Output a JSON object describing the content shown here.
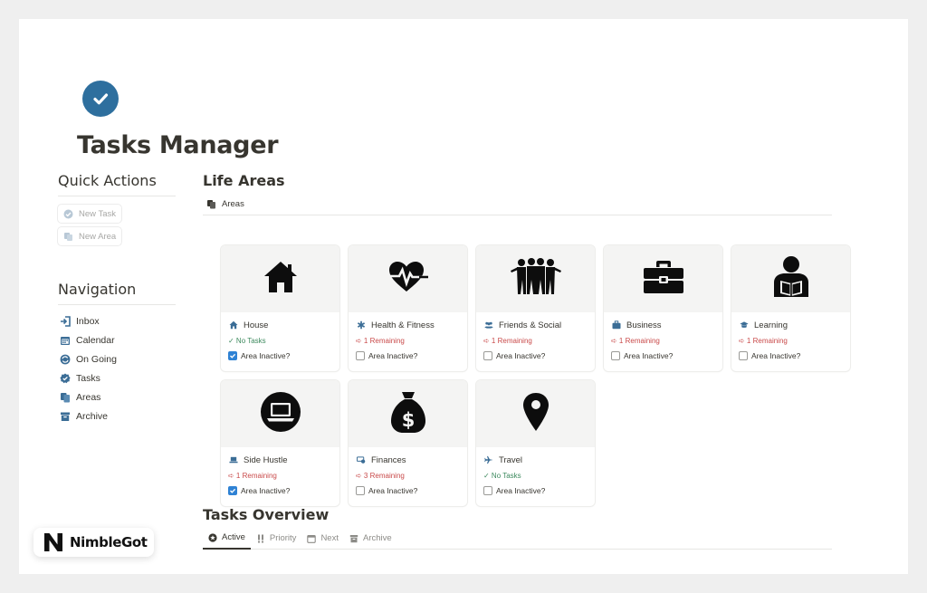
{
  "page": {
    "title": "Tasks Manager",
    "icon": "check-circle-icon"
  },
  "quick_actions": {
    "heading": "Quick Actions",
    "buttons": [
      {
        "label": "New Task",
        "icon": "check-badge-icon"
      },
      {
        "label": "New Area",
        "icon": "copy-icon"
      }
    ]
  },
  "navigation": {
    "heading": "Navigation",
    "items": [
      {
        "label": "Inbox",
        "icon": "inbox-icon"
      },
      {
        "label": "Calendar",
        "icon": "calendar-icon"
      },
      {
        "label": "On Going",
        "icon": "sync-icon"
      },
      {
        "label": "Tasks",
        "icon": "check-badge-icon"
      },
      {
        "label": "Areas",
        "icon": "copy-icon"
      },
      {
        "label": "Archive",
        "icon": "archive-icon"
      }
    ]
  },
  "life_areas": {
    "heading": "Life Areas",
    "view_tab": "Areas",
    "inactive_label": "Area Inactive?",
    "cards": [
      {
        "name": "House",
        "status": "✓ No Tasks",
        "status_type": "none",
        "inactive": true,
        "cover_icon": "house-icon",
        "name_icon": "home-icon"
      },
      {
        "name": "Health & Fitness",
        "status": "➪ 1 Remaining",
        "status_type": "rem",
        "inactive": false,
        "cover_icon": "heartbeat-icon",
        "name_icon": "asterisk-icon"
      },
      {
        "name": "Friends & Social",
        "status": "➪ 1 Remaining",
        "status_type": "rem",
        "inactive": false,
        "cover_icon": "group-icon",
        "name_icon": "people-icon"
      },
      {
        "name": "Business",
        "status": "➪ 1 Remaining",
        "status_type": "rem",
        "inactive": false,
        "cover_icon": "briefcase-icon",
        "name_icon": "briefcase-icon"
      },
      {
        "name": "Learning",
        "status": "➪ 1 Remaining",
        "status_type": "rem",
        "inactive": false,
        "cover_icon": "reader-icon",
        "name_icon": "graduation-cap-icon"
      },
      {
        "name": "Side Hustle",
        "status": "➪ 1 Remaining",
        "status_type": "rem",
        "inactive": true,
        "cover_icon": "laptop-icon",
        "name_icon": "laptop-icon"
      },
      {
        "name": "Finances",
        "status": "➪ 3 Remaining",
        "status_type": "rem",
        "inactive": false,
        "cover_icon": "money-bag-icon",
        "name_icon": "cash-icon"
      },
      {
        "name": "Travel",
        "status": "✓ No Tasks",
        "status_type": "none",
        "inactive": false,
        "cover_icon": "map-pin-icon",
        "name_icon": "airplane-icon"
      }
    ]
  },
  "tasks_overview": {
    "heading": "Tasks Overview",
    "tabs": [
      {
        "label": "Active",
        "icon": "star-circle-icon",
        "active": true
      },
      {
        "label": "Priority",
        "icon": "double-exclamation-icon",
        "active": false
      },
      {
        "label": "Next",
        "icon": "calendar-icon",
        "active": false
      },
      {
        "label": "Archive",
        "icon": "archive-icon",
        "active": false
      }
    ]
  },
  "brand": {
    "name": "NimbleGot"
  },
  "colors": {
    "accent": "#2e6f9e",
    "checkbox": "#2f82d4",
    "remaining": "#c94a4a",
    "no_tasks": "#3d8a5e",
    "icon_blue": "#3b6d96"
  }
}
